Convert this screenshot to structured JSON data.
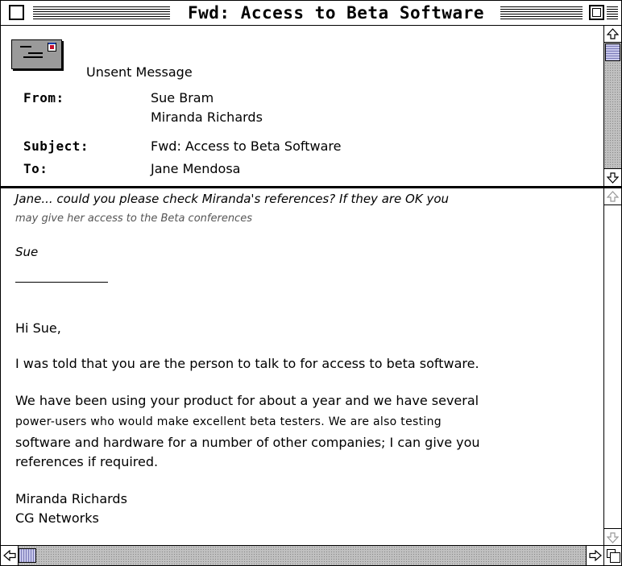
{
  "window": {
    "title": "Fwd: Access to Beta Software"
  },
  "header": {
    "status": "Unsent Message",
    "from_label": "From:",
    "from_values": [
      "Sue Bram",
      "Miranda Richards"
    ],
    "subject_label": "Subject:",
    "subject_value": "Fwd: Access to Beta Software",
    "to_label": "To:",
    "to_value": "Jane Mendosa"
  },
  "body": {
    "note_line1": "Jane... could you please check Miranda's references? If they are OK you",
    "note_line2": "may give her access to the Beta conferences",
    "signature": "Sue",
    "greeting": "Hi Sue,",
    "para1": "I was told that you are the person to talk to for access to beta software.",
    "para2_lines": [
      "We have been using your product for about a year and we have several",
      "power-users who would make excellent beta testers. We are also testing",
      "software and hardware for a number of other companies; I can give you",
      "references if required."
    ],
    "closing_name": "Miranda Richards",
    "closing_company": "CG Networks"
  },
  "icons": {
    "message": "envelope-icon",
    "up": "scroll-up-arrow-icon",
    "down": "scroll-down-arrow-icon",
    "left": "scroll-left-arrow-icon",
    "right": "scroll-right-arrow-icon"
  },
  "colors": {
    "thumb": "#c7c7ea",
    "stamp_red": "#c8102e"
  }
}
